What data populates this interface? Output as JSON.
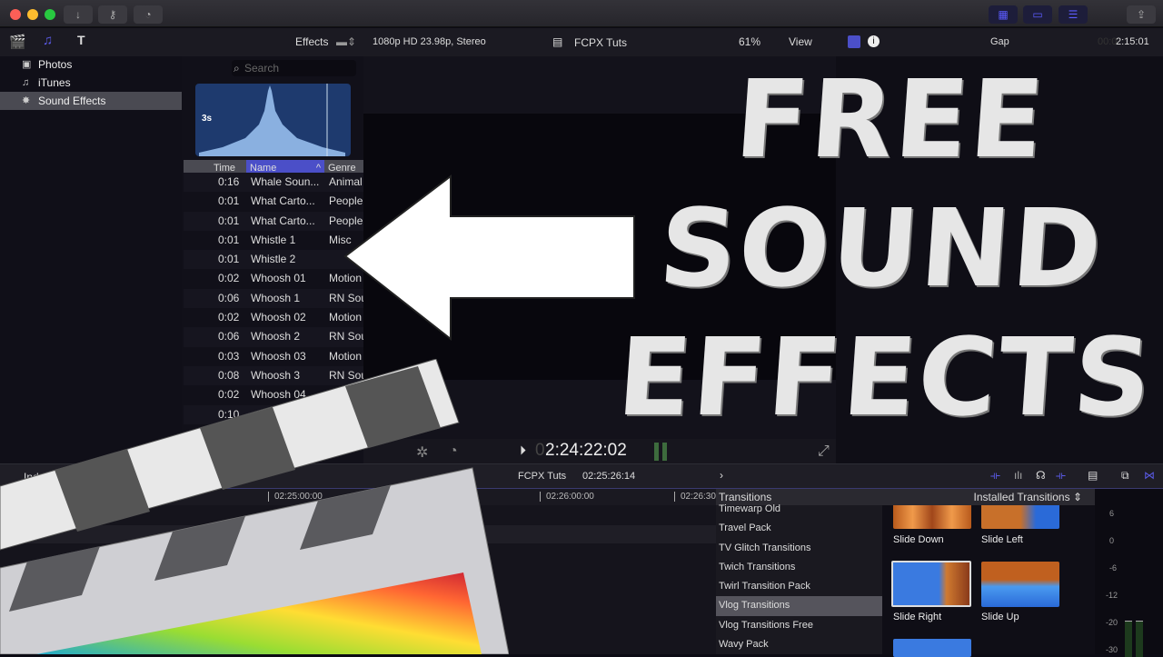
{
  "titlebar": {
    "buttons": [
      "↓",
      "⚷",
      "◔"
    ]
  },
  "header": {
    "effects_label": "Effects",
    "format": "1080p HD 23.98p, Stereo",
    "project": "FCPX Tuts",
    "zoom": "61%",
    "view": "View",
    "inspector_title": "Gap",
    "inspector_time_dim": "00:0",
    "inspector_time": "2:15:01"
  },
  "sidebar": {
    "items": [
      {
        "label": "Photos",
        "icon": "photo-icon"
      },
      {
        "label": "iTunes",
        "icon": "music-icon"
      },
      {
        "label": "Sound Effects",
        "icon": "burst-icon",
        "selected": true
      }
    ]
  },
  "browser": {
    "search_placeholder": "Search",
    "waveform_duration": "3s",
    "columns": [
      "Time",
      "Name",
      "Genre"
    ],
    "rows": [
      [
        "0:16",
        "Whale Soun...",
        "Animal"
      ],
      [
        "0:01",
        "What Carto...",
        "People"
      ],
      [
        "0:01",
        "What Carto...",
        "People"
      ],
      [
        "0:01",
        "Whistle 1",
        "Misc"
      ],
      [
        "0:01",
        "Whistle 2",
        ""
      ],
      [
        "0:02",
        "Whoosh 01",
        "Motion"
      ],
      [
        "0:06",
        "Whoosh 1",
        "RN Sou"
      ],
      [
        "0:02",
        "Whoosh 02",
        "Motion"
      ],
      [
        "0:06",
        "Whoosh 2",
        "RN Sou"
      ],
      [
        "0:03",
        "Whoosh 03",
        "Motion"
      ],
      [
        "0:08",
        "Whoosh 3",
        "RN Sou"
      ],
      [
        "0:02",
        "Whoosh 04",
        ""
      ],
      [
        "0:10",
        "",
        ""
      ]
    ]
  },
  "viewer": {
    "timecode_dim": "0",
    "timecode": "2:24:22:02"
  },
  "timeline": {
    "index_label": "Index",
    "project": "FCPX Tuts",
    "timecode": "02:25:26:14",
    "ruler": [
      "02:25:00:00",
      "02:26:00:00",
      "02:26:30"
    ]
  },
  "transitions": {
    "title": "Transitions",
    "filter": "Installed Transitions",
    "items": [
      "Timewarp Old",
      "Travel Pack",
      "TV Glitch Transitions",
      "Twich Transitions",
      "Twirl Transition Pack",
      "Vlog Transitions",
      "Vlog Transitions Free",
      "Wavy Pack"
    ],
    "selected": "Vlog Transitions",
    "thumbs": [
      "Slide Down",
      "Slide Left",
      "Slide Right",
      "Slide Up"
    ]
  },
  "meters": {
    "scale": [
      "6",
      "0",
      "-6",
      "-12",
      "-20",
      "-30"
    ]
  },
  "overlay": {
    "lines": [
      "FREE",
      "SOUND",
      "EFFECTS"
    ]
  },
  "colors": {
    "accent": "#5a5ae6",
    "selection": "#4b4fc8"
  }
}
